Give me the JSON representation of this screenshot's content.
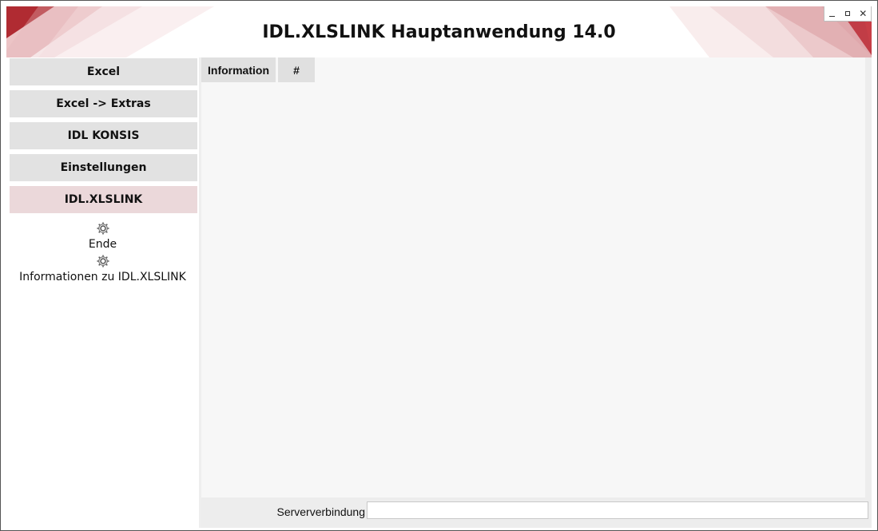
{
  "window": {
    "title": "IDL.XLSLINK Hauptanwendung 14.0",
    "controls": {
      "minimize": "minimize-icon",
      "maximize": "maximize-icon",
      "close": "close-icon"
    }
  },
  "sidebar": {
    "items": [
      {
        "label": "Excel",
        "active": false
      },
      {
        "label": "Excel -> Extras",
        "active": false
      },
      {
        "label": "IDL KONSIS",
        "active": false
      },
      {
        "label": "Einstellungen",
        "active": false
      },
      {
        "label": "IDL.XLSLINK",
        "active": true
      }
    ],
    "subitems": [
      {
        "label": "Ende",
        "icon": "gear-icon"
      },
      {
        "label": "Informationen zu IDL.XLSLINK",
        "icon": "gear-icon"
      }
    ]
  },
  "main": {
    "tabs": [
      {
        "label": "Information"
      },
      {
        "label": "#"
      }
    ]
  },
  "status": {
    "server_label": "Serververbindung",
    "server_value": ""
  },
  "colors": {
    "accent_red": "#b0252c",
    "active_nav": "#ebd8da",
    "nav_bg": "#e2e2e2"
  }
}
